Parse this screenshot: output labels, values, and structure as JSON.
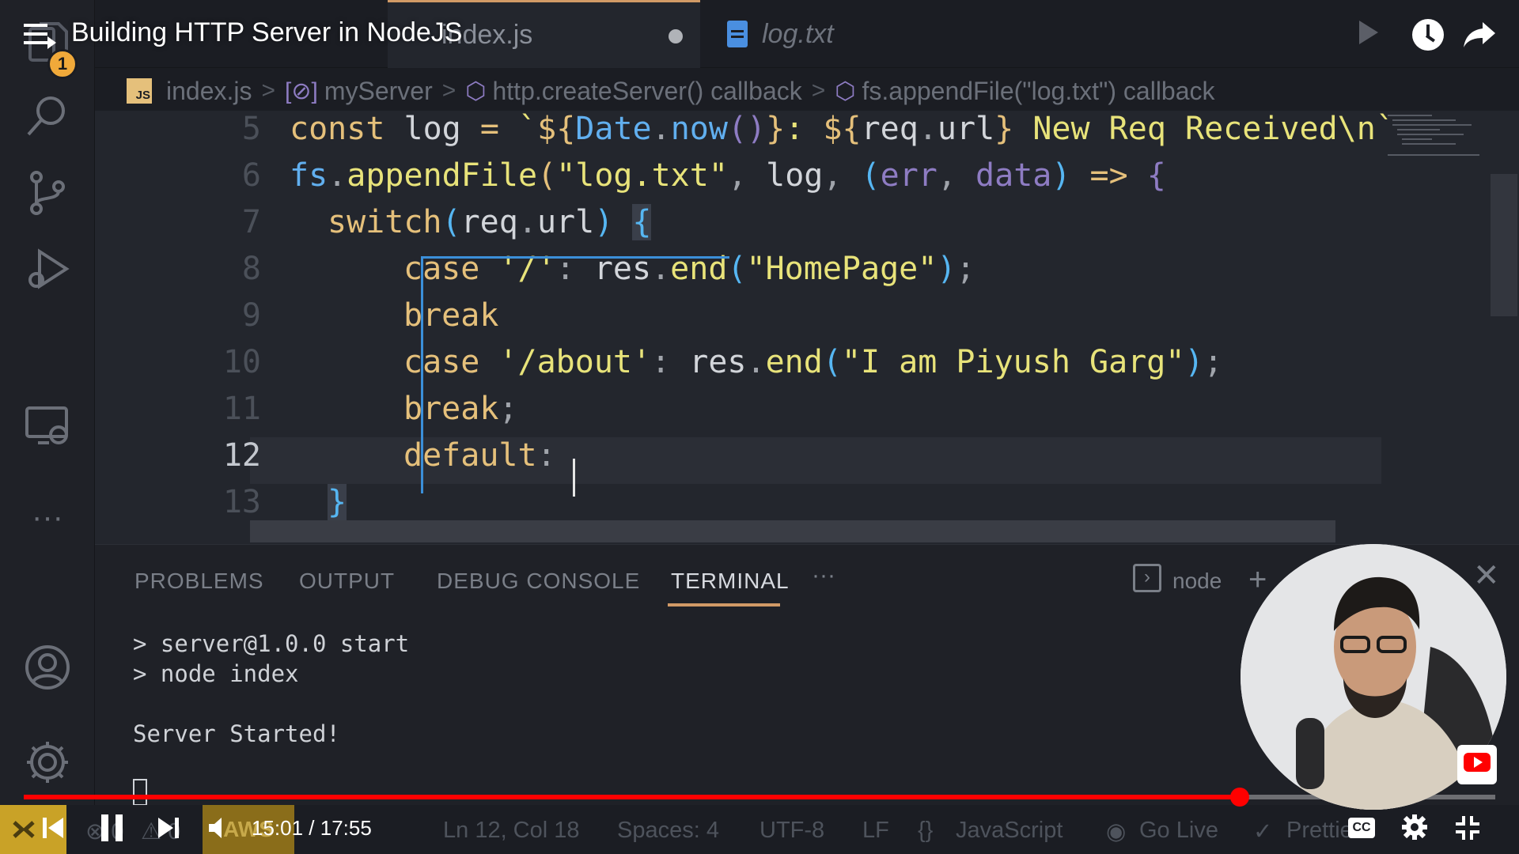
{
  "video": {
    "title": "Building HTTP Server in NodeJS",
    "notification_count": "1",
    "time_current": "15:01",
    "time_separator": " / ",
    "time_total": "17:55",
    "progress": 0.8265,
    "cc_label": "CC"
  },
  "tabs": [
    {
      "label": "index.js",
      "modified": true,
      "active": true
    },
    {
      "label": "log.txt",
      "modified": false,
      "active": false
    }
  ],
  "breadcrumb": {
    "file": "index.js",
    "js_badge": "JS",
    "items": [
      "myServer",
      "http.createServer() callback",
      "fs.appendFile(\"log.txt\") callback"
    ]
  },
  "editor": {
    "line_numbers": [
      "5",
      "6",
      "7",
      "8",
      "9",
      "10",
      "11",
      "12",
      "13"
    ],
    "current_line": "12",
    "code": {
      "l5": [
        "const",
        " log ",
        "=",
        " `",
        "${",
        "Date",
        ".",
        "now",
        "()",
        "}",
        ": ",
        "${",
        "req",
        ".",
        "url",
        "}",
        " New Req Received\\n",
        "`"
      ],
      "l6": [
        "fs",
        ".",
        "appendFile",
        "(",
        "\"log.txt\"",
        ", ",
        "log",
        ", ",
        "(",
        "err",
        ", ",
        "data",
        ")",
        " => ",
        "{"
      ],
      "l7": [
        "switch",
        "(",
        "req",
        ".",
        "url",
        ") ",
        "{"
      ],
      "l8": [
        "case",
        " '/'",
        ": ",
        "res",
        ".",
        "end",
        "(",
        "\"HomePage\"",
        ")",
        ";"
      ],
      "l9": [
        "break"
      ],
      "l10": [
        "case",
        " '/about'",
        ": ",
        "res",
        ".",
        "end",
        "(",
        "\"I am Piyush Garg\"",
        ")",
        ";"
      ],
      "l11": [
        "break",
        ";"
      ],
      "l12": [
        "default",
        ": "
      ],
      "l13": [
        "}"
      ]
    }
  },
  "panel": {
    "tabs": [
      "PROBLEMS",
      "OUTPUT",
      "DEBUG CONSOLE",
      "TERMINAL"
    ],
    "active_tab": "TERMINAL",
    "more": "···",
    "shell": "node",
    "terminal_lines": [
      "> server@1.0.0 start",
      "> node index",
      "Server Started!"
    ]
  },
  "status_bar": {
    "aws": "AWS",
    "problems": "0",
    "warnings": "0",
    "cursor_position": "Ln 12, Col 18",
    "indent": "Spaces: 4",
    "encoding": "UTF-8",
    "eol": "LF",
    "language": "JavaScript",
    "go_live": "Go Live",
    "prettier": "Prettier"
  },
  "colors": {
    "accent": "#d19a66",
    "progress": "#ff0000",
    "keyword": "#e5c07b",
    "string": "#e8e37a",
    "function": "#61afef"
  }
}
